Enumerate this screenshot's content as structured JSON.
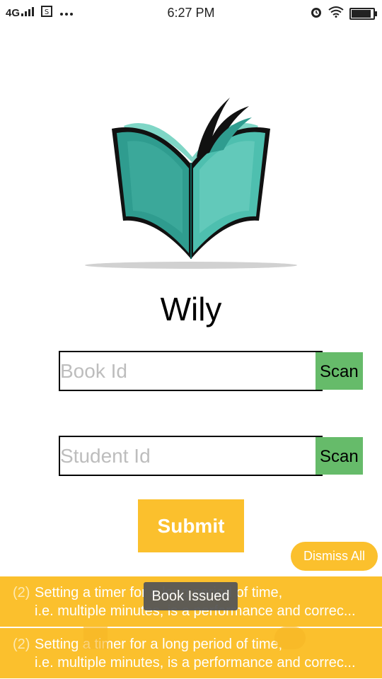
{
  "status_bar": {
    "network": "4G",
    "time": "6:27 PM",
    "battery_level": 0.95,
    "icons": [
      "signal-icon",
      "sim-icon",
      "more-dots-icon",
      "alarm-icon",
      "wifi-icon",
      "battery-icon"
    ]
  },
  "app": {
    "title": "Wily"
  },
  "form": {
    "book_id": {
      "placeholder": "Book Id",
      "value": ""
    },
    "student_id": {
      "placeholder": "Student Id",
      "value": ""
    },
    "scan_label": "Scan",
    "submit_label": "Submit"
  },
  "notifications": {
    "dismiss_all_label": "Dismiss All",
    "items": [
      {
        "count": "(2)",
        "line1": "Setting a timer for a long period of time,",
        "line2": "i.e. multiple minutes, is a performance and correc..."
      },
      {
        "count": "(2)",
        "line1": "Setting a timer for a long period of time,",
        "line2": "i.e. multiple minutes, is a performance and correc..."
      }
    ]
  },
  "toast": {
    "message": "Book Issued"
  },
  "colors": {
    "accent": "#fbc02d",
    "scan_green": "#66bb6a",
    "book_teal": "#2a9d8f"
  }
}
